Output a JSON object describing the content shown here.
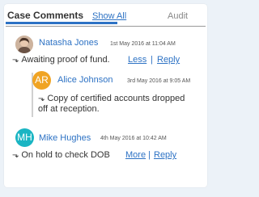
{
  "tabs": {
    "title": "Case Comments",
    "show_all": "Show All",
    "audit": "Audit"
  },
  "comments": [
    {
      "author": "Natasha Jones",
      "timestamp": "1st May 2016 at 11:04 AM",
      "text": "Awaiting proof of fund.",
      "toggle_label": "Less",
      "reply_label": "Reply",
      "avatar_type": "photo"
    },
    {
      "author": "Alice Johnson",
      "initials": "AR",
      "timestamp": "3rd May 2016 at 9:05 AM",
      "text_line1": "Copy of certified accounts dropped",
      "text_line2": "off at reception.",
      "avatar_color": "#f0a424"
    },
    {
      "author": "Mike Hughes",
      "initials": "MH",
      "timestamp": "4th May 2016 at 10:42 AM",
      "text": "On hold to check DOB",
      "toggle_label": "More",
      "reply_label": "Reply",
      "avatar_color": "#1ab5c3"
    }
  ],
  "icons": {
    "reply_arrow": "reply-arrow-icon"
  }
}
